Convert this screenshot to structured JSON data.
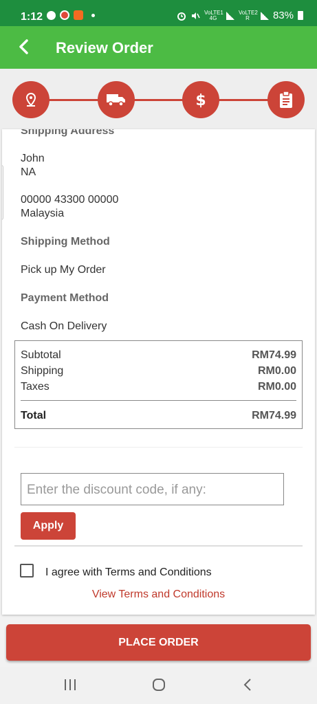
{
  "status_bar": {
    "time": "1:12",
    "battery": "83%",
    "network1": "VoLTE1 4G",
    "network2": "VoLTE2 R"
  },
  "app_bar": {
    "title": "Review Order",
    "color": "#4cbb44"
  },
  "steps": [
    {
      "icon": "location-pin-icon"
    },
    {
      "icon": "truck-icon"
    },
    {
      "icon": "dollar-icon"
    },
    {
      "icon": "clipboard-icon"
    }
  ],
  "shipping_address": {
    "heading": "Shipping Address",
    "name": "John",
    "line2": "NA",
    "postal": "00000 43300 00000",
    "country": "Malaysia"
  },
  "shipping_method": {
    "heading": "Shipping Method",
    "value": "Pick up My Order"
  },
  "payment_method": {
    "heading": "Payment Method",
    "value": "Cash On Delivery"
  },
  "summary": {
    "subtotal_label": "Subtotal",
    "subtotal": "RM74.99",
    "shipping_label": "Shipping",
    "shipping": "RM0.00",
    "taxes_label": "Taxes",
    "taxes": "RM0.00",
    "total_label": "Total",
    "total": "RM74.99"
  },
  "discount": {
    "placeholder": "Enter the discount code, if any:",
    "apply_label": "Apply"
  },
  "terms": {
    "agree_label": "I agree with Terms and Conditions",
    "view_label": "View Terms and Conditions",
    "checked": false
  },
  "place_order_label": "PLACE ORDER",
  "accent_color": "#cc4438"
}
